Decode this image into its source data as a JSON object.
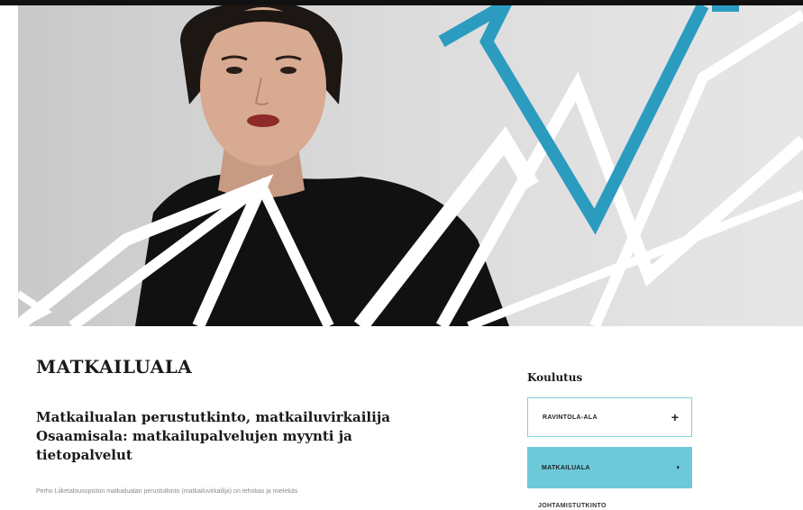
{
  "hero": {
    "image": "woman-portrait-with-geometric-lines"
  },
  "main": {
    "title": "MATKAILUALA",
    "subtitle_lines": [
      "Matkailualan perustutkinto, matkailuvirkailija",
      "Osaamisala: matkailupalvelujen myynti ja",
      "tietopalvelut"
    ],
    "intro_text": "Perho Liiketalousopiston matkailualan perustutkinto (matkailuvirkailija) on tehokas ja mielekäs"
  },
  "sidebar": {
    "heading": "Koulutus",
    "items": [
      {
        "label": "RAVINTOLA-ALA",
        "icon": "plus-icon",
        "sign": "+"
      },
      {
        "label": "MATKAILUALA",
        "icon": "caret-down-icon",
        "sign": "▾"
      },
      {
        "label": "JOHTAMISTUTKINTO"
      }
    ]
  },
  "colors": {
    "accent": "#6dc9d9",
    "accent_border": "#7fd0de",
    "hero_line_blue": "#2b9cc0"
  }
}
